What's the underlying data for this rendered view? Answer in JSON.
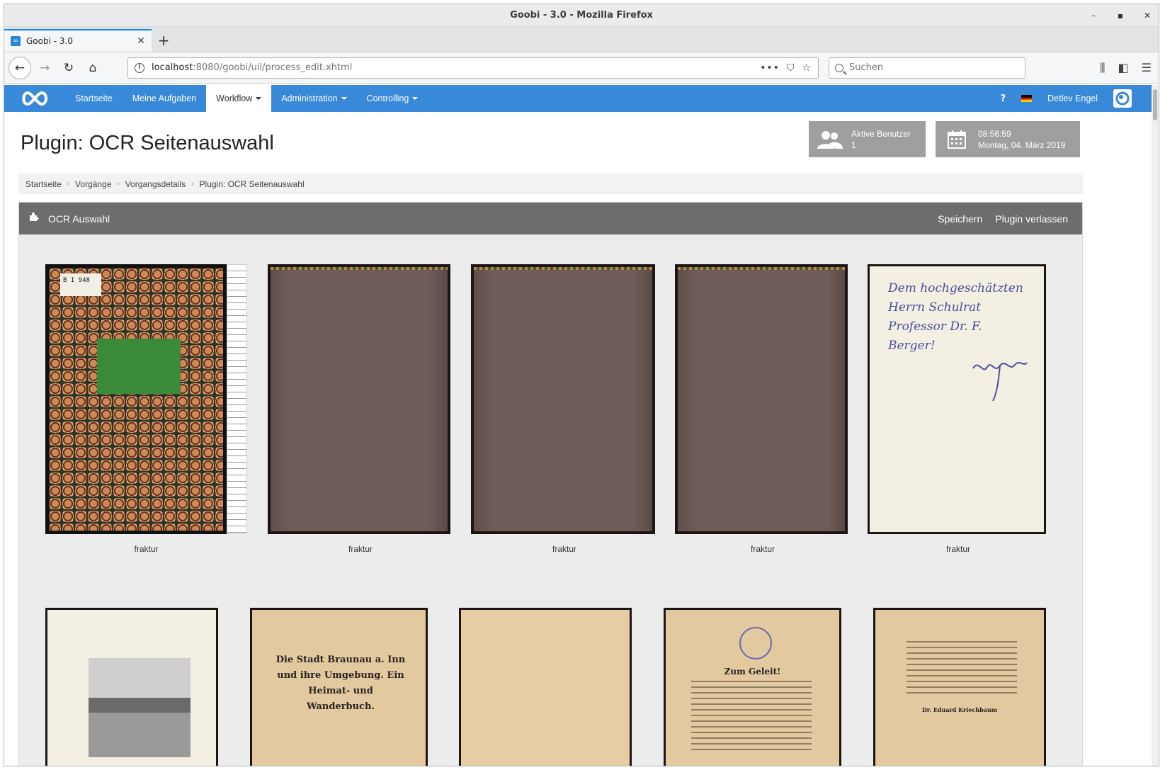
{
  "browser": {
    "window_title": "Goobi - 3.0 - Mozilla Firefox",
    "tab_title": "Goobi - 3.0",
    "url_host": "localhost",
    "url_rest": ":8080/goobi/uii/process_edit.xhtml",
    "search_placeholder": "Suchen"
  },
  "nav": {
    "items": [
      "Startseite",
      "Meine Aufgaben",
      "Workflow",
      "Administration",
      "Controlling"
    ],
    "help": "?",
    "user": "Detlev Engel"
  },
  "page": {
    "title": "Plugin: OCR Seitenauswahl"
  },
  "widgets": {
    "users_label": "Aktive Benutzer",
    "users_count": "1",
    "time": "08:56:59",
    "date": "Montag, 04. März 2019"
  },
  "breadcrumb": [
    "Startseite",
    "Vorgänge",
    "Vorgangsdetails",
    "Plugin: OCR Seitenauswahl"
  ],
  "panel": {
    "title": "OCR Auswahl",
    "save": "Speichern",
    "leave": "Plugin verlassen"
  },
  "thumbnails": [
    {
      "caption": "fraktur",
      "label": "B I 948"
    },
    {
      "caption": "fraktur"
    },
    {
      "caption": "fraktur"
    },
    {
      "caption": "fraktur"
    },
    {
      "caption": "fraktur",
      "label": "Dem hochgeschätzten Herrn Schulrat Professor Dr. F. Berger!"
    },
    {
      "caption": ""
    },
    {
      "caption": "",
      "label": "Die Stadt Braunau a. Inn und ihre Umgebung. Ein Heimat- und Wanderbuch."
    },
    {
      "caption": ""
    },
    {
      "caption": "",
      "label": "Zum Geleit!"
    },
    {
      "caption": "",
      "label": "Dr. Eduard Kriechbaum"
    }
  ]
}
